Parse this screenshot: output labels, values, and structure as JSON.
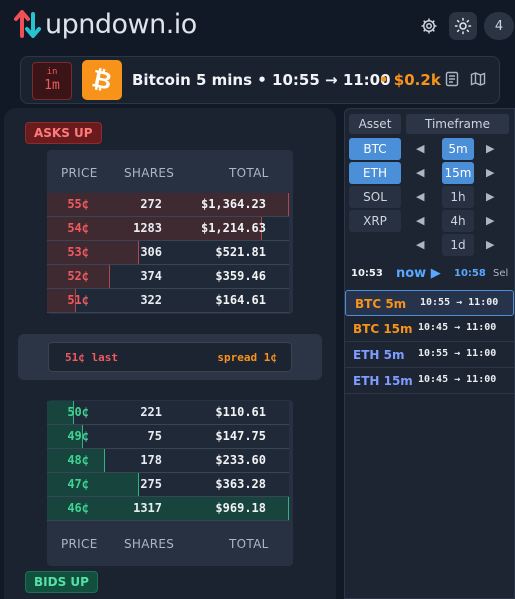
{
  "header": {
    "brand": "upndown.io",
    "notification_count": "4"
  },
  "market": {
    "interval_top": "in",
    "interval_value": "1m",
    "coin_symbol": "₿",
    "title": "Bitcoin 5 mins • 10:55 → 11:00",
    "volume": "• $0.2k"
  },
  "book": {
    "asks_label": "ASKS UP",
    "bids_label": "BIDS UP",
    "headers": {
      "price": "PRICE",
      "shares": "SHARES",
      "total": "TOTAL"
    },
    "asks": [
      {
        "price": "55¢",
        "shares": "272",
        "total": "$1,364.23",
        "depth": 1.0
      },
      {
        "price": "54¢",
        "shares": "1283",
        "total": "$1,214.63",
        "depth": 0.89
      },
      {
        "price": "53¢",
        "shares": "306",
        "total": "$521.81",
        "depth": 0.38
      },
      {
        "price": "52¢",
        "shares": "374",
        "total": "$359.46",
        "depth": 0.26
      },
      {
        "price": "51¢",
        "shares": "322",
        "total": "$164.61",
        "depth": 0.12
      }
    ],
    "last": "51¢ last",
    "spread": "spread 1¢",
    "bids": [
      {
        "price": "50¢",
        "shares": "221",
        "total": "$110.61",
        "depth": 0.11
      },
      {
        "price": "49¢",
        "shares": "75",
        "total": "$147.75",
        "depth": 0.15
      },
      {
        "price": "48¢",
        "shares": "178",
        "total": "$233.60",
        "depth": 0.24
      },
      {
        "price": "47¢",
        "shares": "275",
        "total": "$363.28",
        "depth": 0.38
      },
      {
        "price": "46¢",
        "shares": "1317",
        "total": "$969.18",
        "depth": 1.0
      }
    ]
  },
  "selector": {
    "asset_header": "Asset",
    "timeframe_header": "Timeframe",
    "assets": [
      {
        "label": "BTC",
        "active": true
      },
      {
        "label": "ETH",
        "active": true
      },
      {
        "label": "SOL",
        "active": false
      },
      {
        "label": "XRP",
        "active": false
      }
    ],
    "timeframes": [
      {
        "label": "5m",
        "active": true
      },
      {
        "label": "15m",
        "active": true
      },
      {
        "label": "1h",
        "active": false
      },
      {
        "label": "4h",
        "active": false
      },
      {
        "label": "1d",
        "active": false
      }
    ],
    "time_start": "10:53",
    "now_label": "now ▶",
    "time_end": "10:58",
    "sel_label": "Sel"
  },
  "markets": [
    {
      "name": "BTC 5m",
      "range": "10:55 → 11:00",
      "coin": "btc",
      "active": true
    },
    {
      "name": "BTC 15m",
      "range": "10:45 → 11:00",
      "coin": "btc",
      "active": false
    },
    {
      "name": "ETH 5m",
      "range": "10:55 → 11:00",
      "coin": "eth",
      "active": false
    },
    {
      "name": "ETH 15m",
      "range": "10:45 → 11:00",
      "coin": "eth",
      "active": false
    }
  ],
  "colors": {
    "ask": "#ef5a5f",
    "bid": "#3fd394",
    "accent": "#4b8fd9",
    "btc": "#f7931a"
  }
}
